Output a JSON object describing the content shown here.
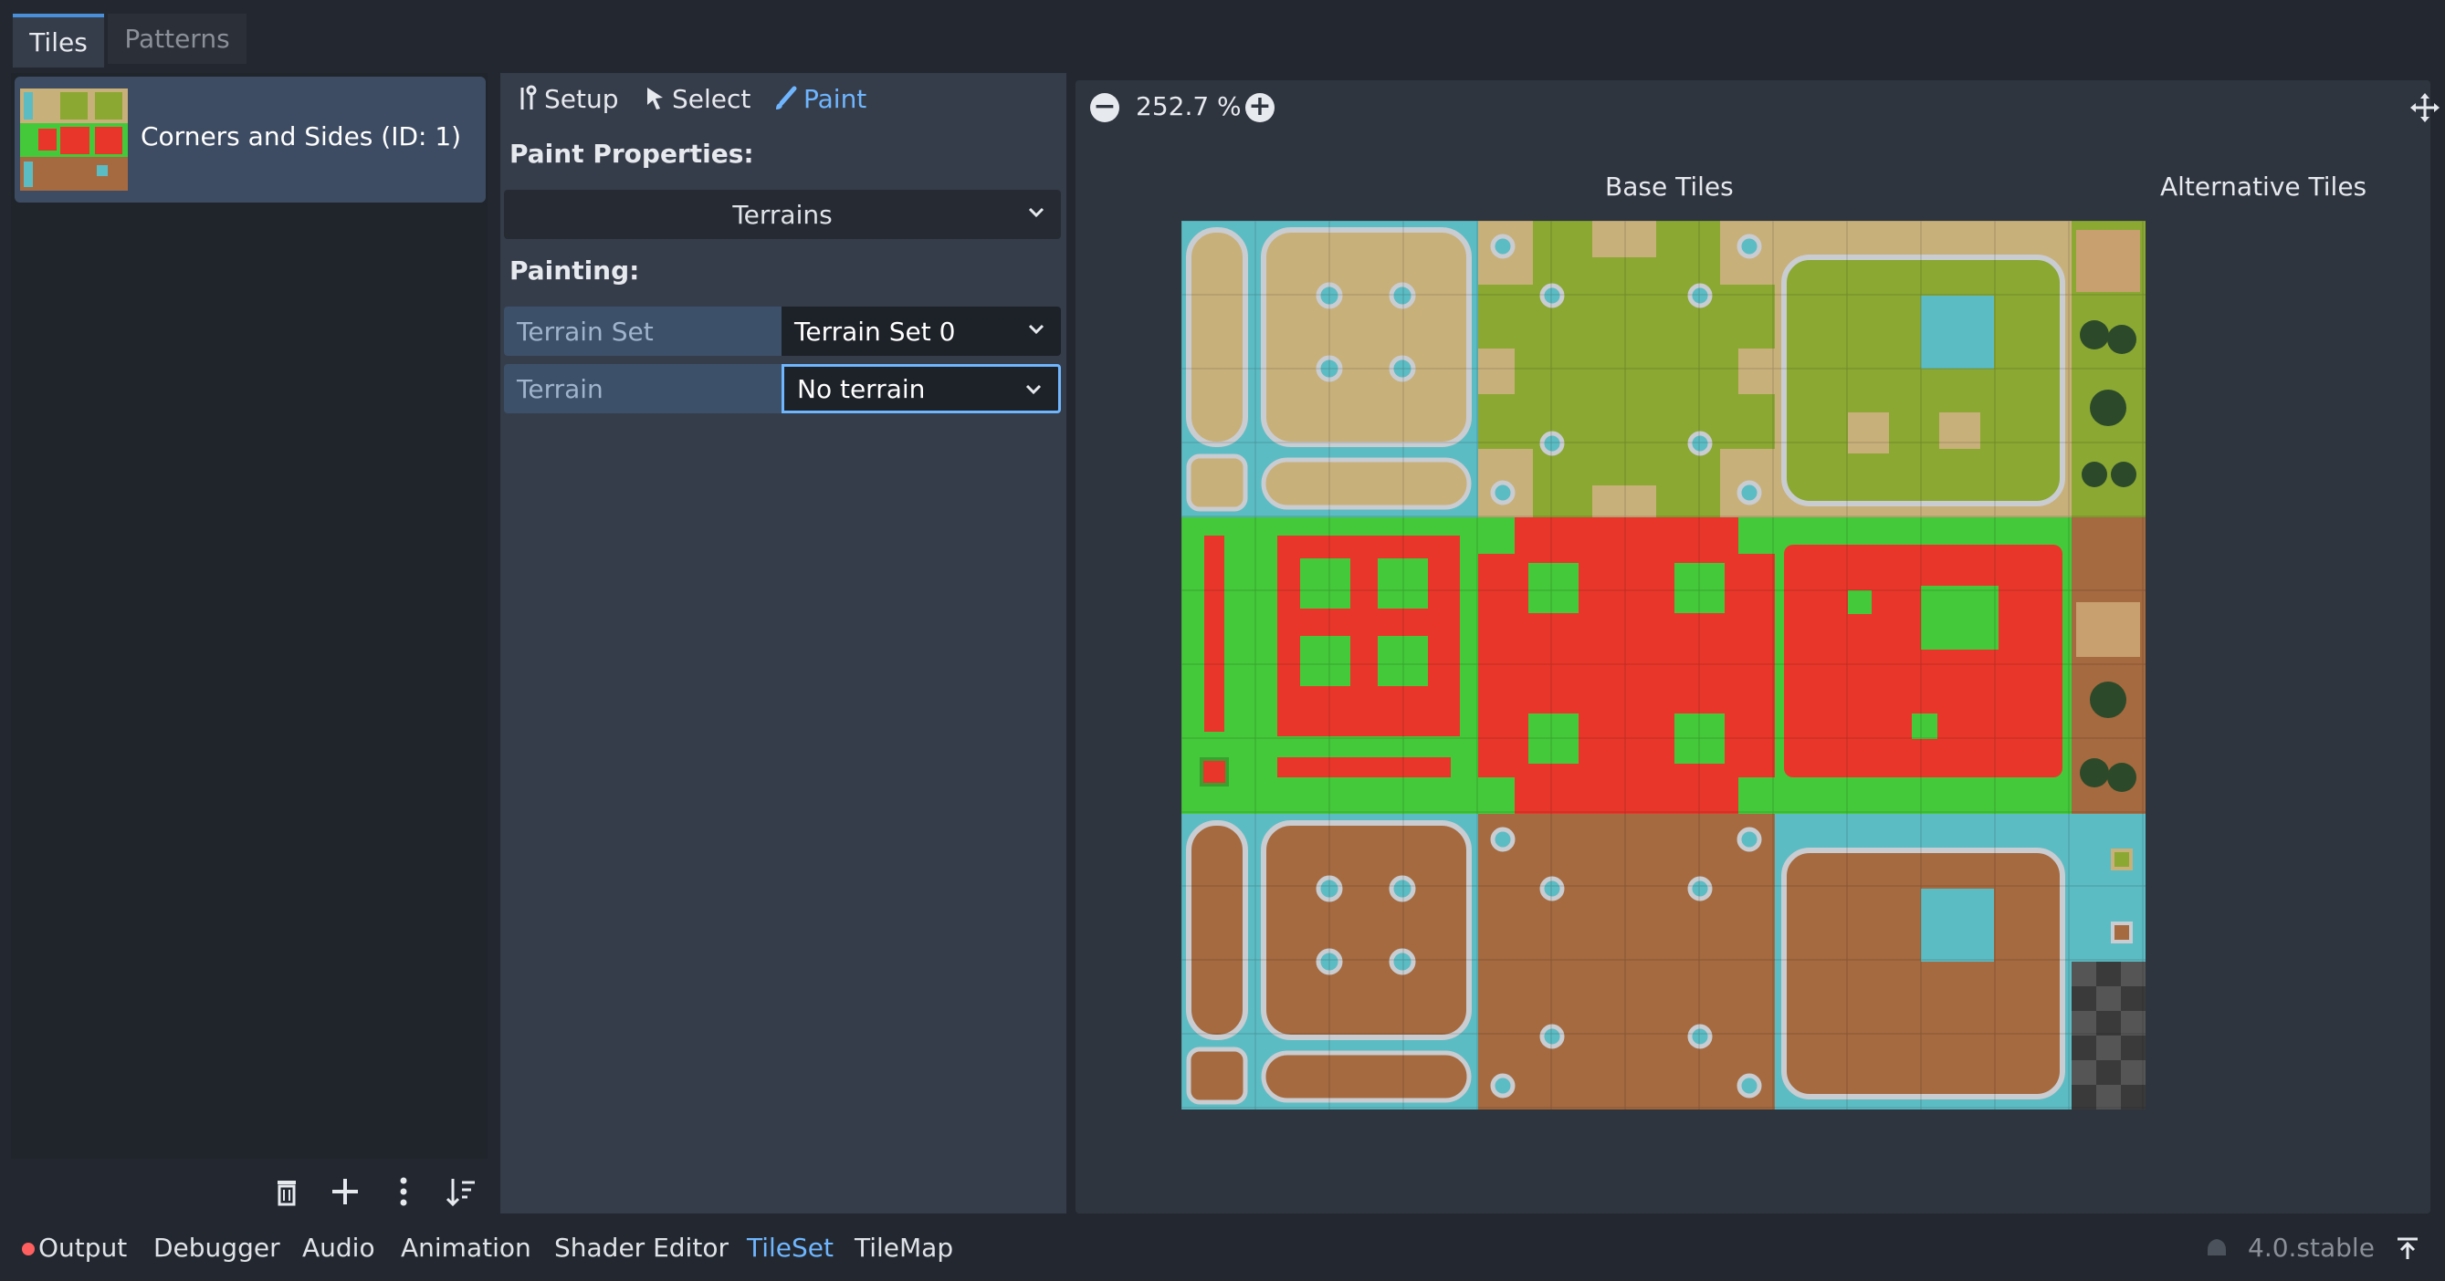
{
  "tabs": [
    {
      "label": "Tiles"
    },
    {
      "label": "Patterns"
    }
  ],
  "atlas": {
    "label": "Corners and Sides (ID: 1)"
  },
  "list_buttons": {
    "delete_icon": "trash-icon",
    "add_icon": "plus-icon",
    "menu_icon": "vertical-dots-icon",
    "sort_icon": "sort-icon"
  },
  "toolbar": {
    "setup": "Setup",
    "select": "Select",
    "paint": "Paint"
  },
  "paint": {
    "properties_title": "Paint Properties:",
    "mode_value": "Terrains",
    "painting_title": "Painting:",
    "rows": [
      {
        "label": "Terrain Set",
        "value": "Terrain Set 0"
      },
      {
        "label": "Terrain",
        "value": "No terrain"
      }
    ]
  },
  "viewer": {
    "zoom": "252.7 %",
    "base_tiles": "Base Tiles",
    "alternative_tiles": "Alternative Tiles"
  },
  "bottom_tabs": [
    {
      "label": "Output"
    },
    {
      "label": "Debugger"
    },
    {
      "label": "Audio"
    },
    {
      "label": "Animation"
    },
    {
      "label": "Shader Editor"
    },
    {
      "label": "TileSet"
    },
    {
      "label": "TileMap"
    }
  ],
  "version": "4.0.stable",
  "colors": {
    "accent": "#6fb6ff",
    "sand": "#c8b07a",
    "grass": "#8aa832",
    "water": "#5cbcc4",
    "green": "#44c93a",
    "red": "#e8372a",
    "dirt": "#a56a3f"
  }
}
